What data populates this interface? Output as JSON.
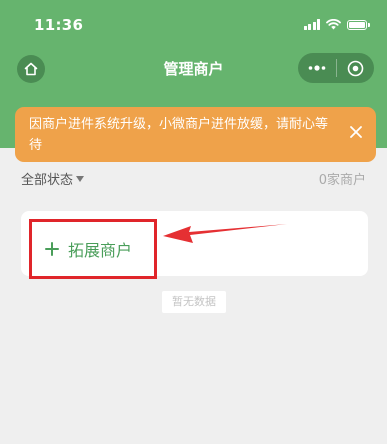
{
  "status_bar": {
    "time": "11:36"
  },
  "nav": {
    "title": "管理商户"
  },
  "notice": {
    "text": "因商户进件系统升级，小微商户进件放缓，请耐心等待"
  },
  "filter": {
    "label": "全部状态",
    "count_text": "0家商户"
  },
  "actions": {
    "expand_label": "拓展商户"
  },
  "empty": {
    "text": "暂无数据"
  },
  "colors": {
    "header_green": "#66b46e",
    "notice_orange": "#efa24a",
    "accent_green": "#4a9e5a",
    "annotation_red": "#e0252a"
  },
  "icons": [
    "home-icon",
    "more-icon",
    "target-icon",
    "close-icon",
    "plus-icon",
    "caret-down-icon",
    "annotation-arrow"
  ]
}
